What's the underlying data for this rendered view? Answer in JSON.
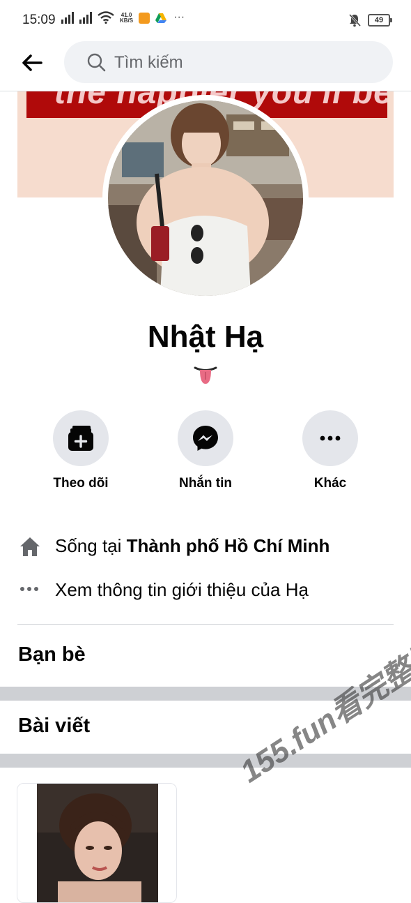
{
  "status_bar": {
    "time": "15:09",
    "net_speed_value": "41.0",
    "net_speed_unit": "KB/S",
    "overflow": "···",
    "battery": "49"
  },
  "search": {
    "placeholder": "Tìm kiếm"
  },
  "profile": {
    "name": "Nhật Hạ",
    "cover_text": "the happier you'll be."
  },
  "actions": [
    {
      "label": "Theo dõi",
      "icon": "follow-icon"
    },
    {
      "label": "Nhắn tin",
      "icon": "messenger-icon"
    },
    {
      "label": "Khác",
      "icon": "more-icon"
    }
  ],
  "info": {
    "lives_prefix": "Sống tại ",
    "lives_city": "Thành phố Hồ Chí Minh",
    "about_link": "Xem thông tin giới thiệu của Hạ"
  },
  "sections": {
    "friends": "Bạn bè",
    "posts": "Bài viết"
  },
  "watermark": "155.fun看完整版",
  "colors": {
    "accent_red": "#b00a0a",
    "button_gray": "#e4e6eb",
    "divider": "#ced0d4",
    "text": "#050505"
  }
}
